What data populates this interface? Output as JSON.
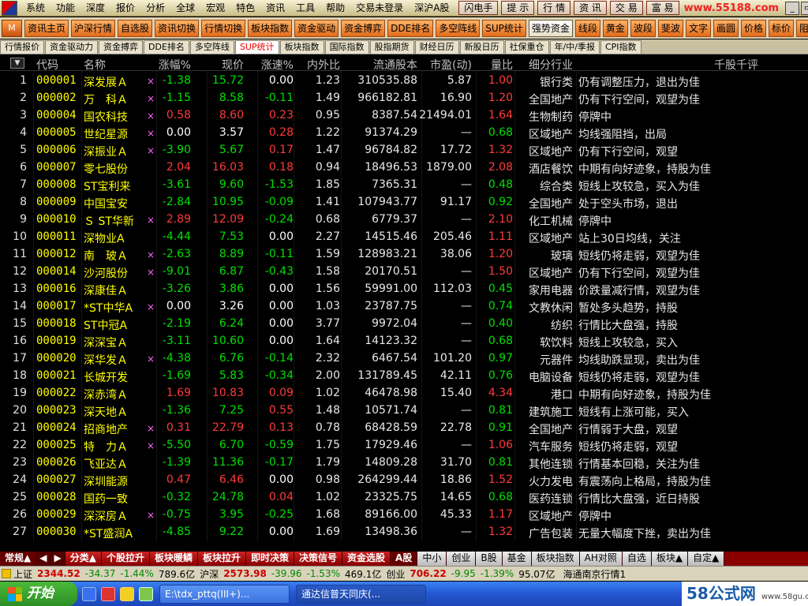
{
  "menubar": {
    "items": [
      "系统",
      "功能",
      "深度",
      "报价",
      "分析",
      "全球",
      "宏观",
      "特色",
      "资讯",
      "工具",
      "帮助",
      "交易未登录",
      "深沪A股"
    ],
    "hot_buttons": [
      "闪电手",
      "提 示",
      "行 情",
      "资 讯",
      "交 易",
      "富 易"
    ],
    "site_url": "www.55188.com"
  },
  "toolbar": {
    "icon_label": "M",
    "buttons": [
      "资讯主页",
      "沪深行情",
      "自选股",
      "资讯切换",
      "行情切换",
      "板块指数",
      "资金驱动",
      "资金博弈",
      "DDE排名",
      "多空阵线",
      "SUP统计",
      "强势资金",
      "线段",
      "黄金",
      "波段",
      "斐波",
      "文字",
      "画圆",
      "价格",
      "标价",
      "阻遭"
    ],
    "active_index": 11
  },
  "tabs": {
    "items": [
      "行情报价",
      "资金驱动力",
      "资金搏弈",
      "DDE排名",
      "多空阵线",
      "SUP统计",
      "板块指数",
      "国际指数",
      "股指期货",
      "财经日历",
      "新股日历",
      "社保重仓",
      "年/中/季报",
      "CPI指数"
    ],
    "active_index": 5
  },
  "table": {
    "sort_arrow": "▼",
    "columns": [
      "代码",
      "名称",
      "涨幅%",
      "现价",
      "涨速%",
      "内外比",
      "流通股本",
      "市盈(动)",
      "量比",
      "细分行业",
      "千股千评"
    ],
    "rows": [
      {
        "idx": "1",
        "code": "000001",
        "name": "深发展Ａ",
        "mark": "×",
        "pct": "-1.38",
        "price": "15.72",
        "speed": "0.00",
        "io": "1.23",
        "cap": "310535.88",
        "pe": "5.87",
        "vr": "1.00",
        "ind": "银行类",
        "cmt": "仍有调整压力，退出为佳"
      },
      {
        "idx": "2",
        "code": "000002",
        "name": "万　科Ａ",
        "mark": "×",
        "pct": "-1.15",
        "price": "8.58",
        "speed": "-0.11",
        "io": "1.49",
        "cap": "966182.81",
        "pe": "16.90",
        "vr": "1.20",
        "ind": "全国地产",
        "cmt": "仍有下行空间，观望为佳"
      },
      {
        "idx": "3",
        "code": "000004",
        "name": "国农科技",
        "mark": "×",
        "pct": "0.58",
        "price": "8.60",
        "speed": "0.23",
        "io": "0.95",
        "cap": "8387.54",
        "pe": "21494.01",
        "vr": "1.64",
        "ind": "生物制药",
        "cmt": "停牌中"
      },
      {
        "idx": "4",
        "code": "000005",
        "name": "世纪星源",
        "mark": "×",
        "pct": "0.00",
        "price": "3.57",
        "speed": "0.28",
        "io": "1.22",
        "cap": "91374.29",
        "pe": "—",
        "vr": "0.68",
        "ind": "区域地产",
        "cmt": "均线强阻挡，出局"
      },
      {
        "idx": "5",
        "code": "000006",
        "name": "深振业Ａ",
        "mark": "×",
        "pct": "-3.90",
        "price": "5.67",
        "speed": "0.17",
        "io": "1.47",
        "cap": "96784.82",
        "pe": "17.72",
        "vr": "1.32",
        "ind": "区域地产",
        "cmt": "仍有下行空间，观望"
      },
      {
        "idx": "6",
        "code": "000007",
        "name": "零七股份",
        "mark": "",
        "pct": "2.04",
        "price": "16.03",
        "speed": "0.18",
        "io": "0.94",
        "cap": "18496.53",
        "pe": "1879.00",
        "vr": "2.08",
        "ind": "酒店餐饮",
        "cmt": "中期有向好迹象，持股为佳"
      },
      {
        "idx": "7",
        "code": "000008",
        "name": "ST宝利来",
        "mark": "",
        "pct": "-3.61",
        "price": "9.60",
        "speed": "-1.53",
        "io": "1.85",
        "cap": "7365.31",
        "pe": "—",
        "vr": "0.48",
        "ind": "综合类",
        "cmt": "短线上攻较急，买入为佳"
      },
      {
        "idx": "8",
        "code": "000009",
        "name": "中国宝安",
        "mark": "",
        "pct": "-2.84",
        "price": "10.95",
        "speed": "-0.09",
        "io": "1.41",
        "cap": "107943.77",
        "pe": "91.17",
        "vr": "0.92",
        "ind": "全国地产",
        "cmt": "处于空头市场，退出"
      },
      {
        "idx": "9",
        "code": "000010",
        "name": "Ｓ ST华新",
        "mark": "×",
        "pct": "2.89",
        "price": "12.09",
        "speed": "-0.24",
        "io": "0.68",
        "cap": "6779.37",
        "pe": "—",
        "vr": "2.10",
        "ind": "化工机械",
        "cmt": "停牌中"
      },
      {
        "idx": "10",
        "code": "000011",
        "name": "深物业A",
        "mark": "",
        "pct": "-4.44",
        "price": "7.53",
        "speed": "0.00",
        "io": "2.27",
        "cap": "14515.46",
        "pe": "205.46",
        "vr": "1.11",
        "ind": "区域地产",
        "cmt": "站上30日均线，关注"
      },
      {
        "idx": "11",
        "code": "000012",
        "name": "南　玻Ａ",
        "mark": "×",
        "pct": "-2.63",
        "price": "8.89",
        "speed": "-0.11",
        "io": "1.59",
        "cap": "128983.21",
        "pe": "38.06",
        "vr": "1.20",
        "ind": "玻璃",
        "cmt": "短线仍将走弱，观望为佳"
      },
      {
        "idx": "12",
        "code": "000014",
        "name": "沙河股份",
        "mark": "×",
        "pct": "-9.01",
        "price": "6.87",
        "speed": "-0.43",
        "io": "1.58",
        "cap": "20170.51",
        "pe": "—",
        "vr": "1.50",
        "ind": "区域地产",
        "cmt": "仍有下行空间，观望为佳"
      },
      {
        "idx": "13",
        "code": "000016",
        "name": "深康佳Ａ",
        "mark": "",
        "pct": "-3.26",
        "price": "3.86",
        "speed": "0.00",
        "io": "1.56",
        "cap": "59991.00",
        "pe": "112.03",
        "vr": "0.45",
        "ind": "家用电器",
        "cmt": "价跌量减行情，观望为佳"
      },
      {
        "idx": "14",
        "code": "000017",
        "name": "*ST中华A",
        "mark": "×",
        "pct": "0.00",
        "price": "3.26",
        "speed": "0.00",
        "io": "1.03",
        "cap": "23787.75",
        "pe": "—",
        "vr": "0.74",
        "ind": "文教休闲",
        "cmt": "暂处多头趋势，持股"
      },
      {
        "idx": "15",
        "code": "000018",
        "name": "ST中冠A",
        "mark": "",
        "pct": "-2.19",
        "price": "6.24",
        "speed": "0.00",
        "io": "3.77",
        "cap": "9972.04",
        "pe": "—",
        "vr": "0.40",
        "ind": "纺织",
        "cmt": "行情比大盘强，持股"
      },
      {
        "idx": "16",
        "code": "000019",
        "name": "深深宝Ａ",
        "mark": "",
        "pct": "-3.11",
        "price": "10.60",
        "speed": "0.00",
        "io": "1.64",
        "cap": "14123.32",
        "pe": "—",
        "vr": "0.68",
        "ind": "软饮料",
        "cmt": "短线上攻较急，买入"
      },
      {
        "idx": "17",
        "code": "000020",
        "name": "深华发Ａ",
        "mark": "×",
        "pct": "-4.38",
        "price": "6.76",
        "speed": "-0.14",
        "io": "2.32",
        "cap": "6467.54",
        "pe": "101.20",
        "vr": "0.97",
        "ind": "元器件",
        "cmt": "均线助跌显现，卖出为佳"
      },
      {
        "idx": "18",
        "code": "000021",
        "name": "长城开发",
        "mark": "",
        "pct": "-1.69",
        "price": "5.83",
        "speed": "-0.34",
        "io": "2.00",
        "cap": "131789.45",
        "pe": "42.11",
        "vr": "0.76",
        "ind": "电脑设备",
        "cmt": "短线仍将走弱，观望为佳"
      },
      {
        "idx": "19",
        "code": "000022",
        "name": "深赤湾Ａ",
        "mark": "",
        "pct": "1.69",
        "price": "10.83",
        "speed": "0.09",
        "io": "1.02",
        "cap": "46478.98",
        "pe": "15.40",
        "vr": "4.34",
        "ind": "港口",
        "cmt": "中期有向好迹象，持股为佳"
      },
      {
        "idx": "20",
        "code": "000023",
        "name": "深天地Ａ",
        "mark": "",
        "pct": "-1.36",
        "price": "7.25",
        "speed": "0.55",
        "io": "1.48",
        "cap": "10571.74",
        "pe": "—",
        "vr": "0.81",
        "ind": "建筑施工",
        "cmt": "短线有上涨可能，买入"
      },
      {
        "idx": "21",
        "code": "000024",
        "name": "招商地产",
        "mark": "×",
        "pct": "0.31",
        "price": "22.79",
        "speed": "0.13",
        "io": "0.78",
        "cap": "68428.59",
        "pe": "22.78",
        "vr": "0.91",
        "ind": "全国地产",
        "cmt": "行情弱于大盘，观望"
      },
      {
        "idx": "22",
        "code": "000025",
        "name": "特　力Ａ",
        "mark": "×",
        "pct": "-5.50",
        "price": "6.70",
        "speed": "-0.59",
        "io": "1.75",
        "cap": "17929.46",
        "pe": "—",
        "vr": "1.06",
        "ind": "汽车服务",
        "cmt": "短线仍将走弱，观望"
      },
      {
        "idx": "23",
        "code": "000026",
        "name": "飞亚达Ａ",
        "mark": "",
        "pct": "-1.39",
        "price": "11.36",
        "speed": "-0.17",
        "io": "1.79",
        "cap": "14809.28",
        "pe": "31.70",
        "vr": "0.81",
        "ind": "其他连锁",
        "cmt": "行情基本回稳，关注为佳"
      },
      {
        "idx": "24",
        "code": "000027",
        "name": "深圳能源",
        "mark": "",
        "pct": "0.47",
        "price": "6.46",
        "speed": "0.00",
        "io": "0.98",
        "cap": "264299.44",
        "pe": "18.86",
        "vr": "1.52",
        "ind": "火力发电",
        "cmt": "有震荡向上格局，持股为佳"
      },
      {
        "idx": "25",
        "code": "000028",
        "name": "国药一致",
        "mark": "",
        "pct": "-0.32",
        "price": "24.78",
        "speed": "0.04",
        "io": "1.02",
        "cap": "23325.75",
        "pe": "14.65",
        "vr": "0.68",
        "ind": "医药连锁",
        "cmt": "行情比大盘强，近日持股"
      },
      {
        "idx": "26",
        "code": "000029",
        "name": "深深房Ａ",
        "mark": "×",
        "pct": "-0.75",
        "price": "3.95",
        "speed": "-0.25",
        "io": "1.68",
        "cap": "89166.00",
        "pe": "45.33",
        "vr": "1.17",
        "ind": "区域地产",
        "cmt": "停牌中"
      },
      {
        "idx": "27",
        "code": "000030",
        "name": "*ST盛润A",
        "mark": "",
        "pct": "-4.85",
        "price": "9.22",
        "speed": "0.00",
        "io": "1.69",
        "cap": "13498.36",
        "pe": "—",
        "vr": "1.32",
        "ind": "广告包装",
        "cmt": "无量大幅度下挫，卖出为佳"
      }
    ]
  },
  "bottom_tabs": {
    "items": [
      {
        "label": "常规▲",
        "style": "sel"
      },
      {
        "label": "◀",
        "style": "arrow"
      },
      {
        "label": "▶",
        "style": "arrow"
      },
      {
        "label": "分类▲",
        "style": "red"
      },
      {
        "label": "个股拉升",
        "style": "red"
      },
      {
        "label": "板块暖鳞",
        "style": "red"
      },
      {
        "label": "板块拉升",
        "style": "red"
      },
      {
        "label": "即时决策",
        "style": "red"
      },
      {
        "label": "决策信号",
        "style": "red"
      },
      {
        "label": "资金选股",
        "style": "red"
      },
      {
        "label": "A股",
        "style": "sel"
      },
      {
        "label": "中小",
        "style": "lt"
      },
      {
        "label": "创业",
        "style": "lt"
      },
      {
        "label": "B股",
        "style": "lt"
      },
      {
        "label": "基金",
        "style": "lt"
      },
      {
        "label": "板块指数",
        "style": "lt"
      },
      {
        "label": "AH对照",
        "style": "lt"
      },
      {
        "label": "自选",
        "style": "lt"
      },
      {
        "label": "板块▲",
        "style": "lt"
      },
      {
        "label": "自定▲",
        "style": "lt"
      }
    ]
  },
  "index_bar": {
    "sh_name": "上证",
    "sh_value": "2344.52",
    "sh_change": "-34.37",
    "sh_pct": "-1.44%",
    "sh_amount": "789.6亿",
    "sz_name": "沪深",
    "sz_value": "2573.98",
    "sz_change": "-39.96",
    "sz_pct": "-1.53%",
    "sz_amount": "469.1亿",
    "cy_name": "创业",
    "cy_value": "706.22",
    "cy_change": "-9.95",
    "cy_pct": "-1.39%",
    "cy_amount": "95.07亿",
    "broker": "海通南京行情1"
  },
  "taskbar": {
    "start_label": "开始",
    "tasks": [
      "E:\\tdx_pttq(III+)...",
      "通达信普天同庆(..."
    ],
    "watermark": "58公式网",
    "watermark_url": "www.58gu.com"
  },
  "colors": {
    "up": "#ff3a3a",
    "down": "#00e000",
    "flat": "#ffffff",
    "code": "#ffff00"
  }
}
